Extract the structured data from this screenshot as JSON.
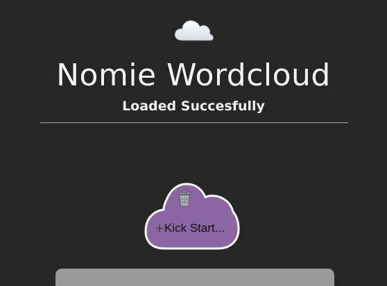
{
  "header": {
    "icon": "cloud-icon",
    "title": "Nomie Wordcloud",
    "subtitle": "Loaded Succesfully"
  },
  "kick_start_button": {
    "label": "Kick Start...",
    "icons": [
      "trash-icon",
      "plus-icon"
    ],
    "fill_color": "#8c65a3",
    "border_color": "#ffffff"
  },
  "colors": {
    "background": "#262626",
    "text": "#f4f4f4",
    "panel": "#9a9a9a"
  }
}
